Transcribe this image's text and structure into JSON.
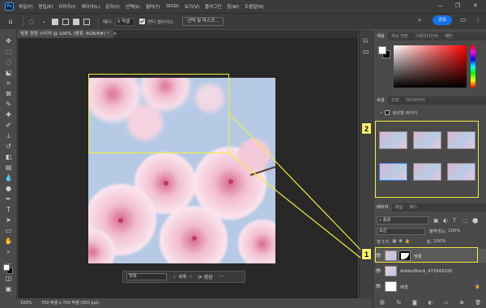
{
  "menu": {
    "app_logo": "Ps",
    "items": [
      "파일(F)",
      "편집(E)",
      "이미지(I)",
      "레이어(L)",
      "문자(Y)",
      "선택(S)",
      "필터(T)",
      "3D(D)",
      "보기(V)",
      "플러그인",
      "창(W)",
      "도움말(H)"
    ],
    "window_controls": [
      "—",
      "❐",
      "✕"
    ]
  },
  "options_bar": {
    "feather_label": "페더:",
    "feather_value": "0 픽셀",
    "antialias_label": "앤티 앨리어스",
    "select_mask_button": "선택 및 마스크...",
    "share_button": "공유"
  },
  "document": {
    "tab_title": "벚꽃 원형 스티커 @ 100% (벚꽃, RGB/8#) *",
    "close_glyph": "×"
  },
  "contextual_taskbar": {
    "prompt_placeholder": "벚꽃",
    "counter": "4/6",
    "generate_label": "생성",
    "more": "···"
  },
  "status_bar": {
    "zoom": "100%",
    "doc_info": "709 픽셀 x 709 픽셀 (300 ppi)"
  },
  "color_panel": {
    "tabs": [
      "색상",
      "색상 견본",
      "그레이디언트",
      "패턴"
    ],
    "foreground": "#ffffff",
    "background": "#000000"
  },
  "properties_panel": {
    "tabs": [
      "속성",
      "조정",
      "라이브러리"
    ],
    "layer_type": "생성형 레이어",
    "variant_count": 6,
    "selected_variant": 4
  },
  "layers_panel": {
    "tabs": [
      "레이어",
      "채널",
      "패스"
    ],
    "search_placeholder": "종류",
    "blend_mode": "표준",
    "opacity_label": "불투명도:",
    "opacity_value": "100%",
    "lock_label": "잠그기:",
    "fill_label": "칠:",
    "fill_value": "100%",
    "layers": [
      {
        "name": "벚꽃",
        "type": "generative",
        "active": true
      },
      {
        "name": "AdobeStock_472049320",
        "type": "image",
        "active": false
      },
      {
        "name": "배경",
        "type": "background",
        "active": false
      }
    ],
    "bottom_icons": [
      "link-icon",
      "fx-icon",
      "mask-icon",
      "adjustment-icon",
      "group-icon",
      "new-layer-icon",
      "trash-icon"
    ]
  },
  "callouts": {
    "one": "1",
    "two": "2"
  },
  "colors": {
    "accent": "#1473e6",
    "callout_fill": "#fcf26a",
    "highlight_border": "#f2ee3a"
  }
}
